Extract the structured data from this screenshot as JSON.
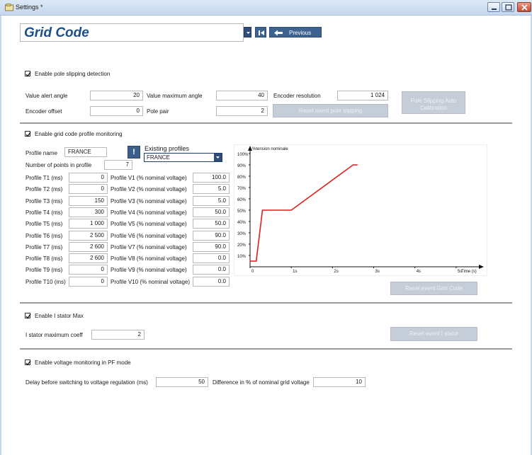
{
  "window": {
    "title": "Settings *"
  },
  "header": {
    "title": "Grid Code",
    "previous_label": "Previous"
  },
  "pole": {
    "checkbox_label": "Enable pole slipping detection",
    "value_alert_angle_label": "Value alert angle",
    "value_alert_angle": "20",
    "value_max_angle_label": "Value maximum angle",
    "value_max_angle": "40",
    "encoder_resolution_label": "Encoder resolution",
    "encoder_resolution": "1 024",
    "auto_calibration_label_1": "Pole Slipping Auto",
    "auto_calibration_label_2": "Calibration",
    "encoder_offset_label": "Encoder offset",
    "encoder_offset": "0",
    "pole_pair_label": "Pole pair",
    "pole_pair": "2",
    "reset_label": "Reset event pole slipping"
  },
  "gridcode": {
    "checkbox_label": "Enable grid code profile monitoring",
    "profile_name_label": "Profile name",
    "profile_name": "FRANCE",
    "info_icon": "exclamation-icon",
    "existing_profiles_label": "Existing profiles",
    "existing_profile_selected": "FRANCE",
    "num_points_label": "Number of points in profile",
    "num_points": "7",
    "rows": [
      {
        "t_label": "Profile T1 (ms)",
        "t": "0",
        "v_label": "Profile V1 (% nominal voltage)",
        "v": "100.0"
      },
      {
        "t_label": "Profile T2 (ms)",
        "t": "0",
        "v_label": "Profile V2 (% nominal voltage)",
        "v": "5.0"
      },
      {
        "t_label": "Profile T3 (ms)",
        "t": "150",
        "v_label": "Profile V3 (% nominal voltage)",
        "v": "5.0"
      },
      {
        "t_label": "Profile T4 (ms)",
        "t": "300",
        "v_label": "Profile V4 (% nominal voltage)",
        "v": "50.0"
      },
      {
        "t_label": "Profile T5 (ms)",
        "t": "1 000",
        "v_label": "Profile V5 (% nominal voltage)",
        "v": "50.0"
      },
      {
        "t_label": "Profile T6 (ms)",
        "t": "2 500",
        "v_label": "Profile V6 (% nominal voltage)",
        "v": "90.0"
      },
      {
        "t_label": "Profile T7 (ms)",
        "t": "2 600",
        "v_label": "Profile V7 (% nominal voltage)",
        "v": "90.0"
      },
      {
        "t_label": "Profile T8 (ms)",
        "t": "2 600",
        "v_label": "Profile V8 (% nominal voltage)",
        "v": "0.0"
      },
      {
        "t_label": "Profile T9 (ms)",
        "t": "0",
        "v_label": "Profile V9 (% nominal voltage)",
        "v": "0.0"
      },
      {
        "t_label": "Profile T10 (ms)",
        "t": "0",
        "v_label": "Profile V10 (% nominal voltage)",
        "v": "0.0"
      }
    ],
    "reset_label": "Reset event Grid Code"
  },
  "chart_data": {
    "type": "line",
    "ylabel": "%tension nominale",
    "xlabel": "Time (s)",
    "y_ticks": [
      "100%",
      "90%",
      "80%",
      "70%",
      "60%",
      "50%",
      "40%",
      "30%",
      "20%",
      "10%"
    ],
    "x_ticks": [
      "0",
      "1s",
      "2s",
      "3s",
      "4s",
      "5s"
    ],
    "xlim": [
      0,
      5.5
    ],
    "ylim": [
      0,
      100
    ],
    "color": "#e31b1b",
    "series": [
      {
        "x": [
          0,
          0.15,
          0.3,
          1.0,
          2.5,
          2.6
        ],
        "y": [
          5,
          5,
          50,
          50,
          90,
          90
        ]
      }
    ]
  },
  "istator": {
    "checkbox_label": "Enable I stator Max",
    "coeff_label": "I stator maximum coeff",
    "coeff": "2",
    "reset_label": "Reset event I stator"
  },
  "voltage": {
    "checkbox_label": "Enable voltage monitoring in PF mode",
    "delay_label": "Delay before switching to voltage regulation (ms)",
    "delay": "50",
    "difference_label": "Difference in % of nominal grid voltage",
    "difference": "10"
  }
}
